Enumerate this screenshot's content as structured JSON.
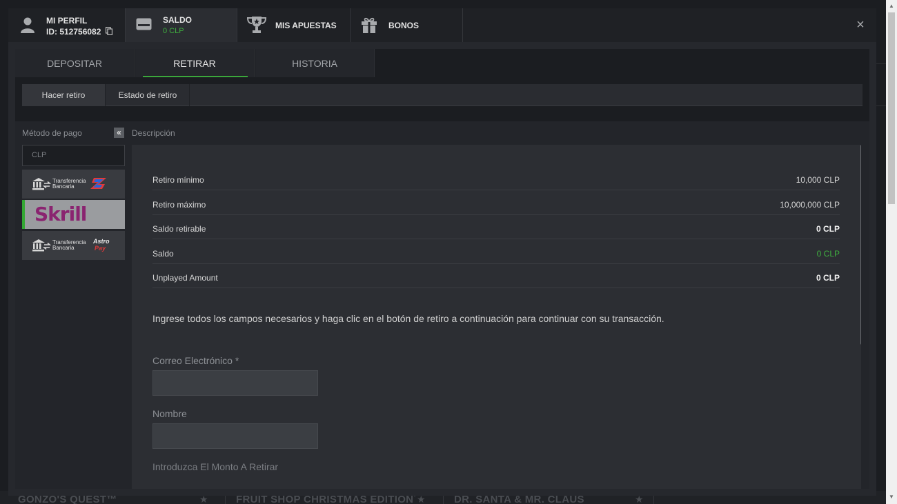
{
  "tabs": [
    {
      "title": "MI PERFIL",
      "sub": "ID: 512756082"
    },
    {
      "title": "SALDO",
      "sub": "0 CLP"
    },
    {
      "title": "MIS APUESTAS"
    },
    {
      "title": "BONOS"
    }
  ],
  "close_label": "×",
  "subtabs": [
    "DEPOSITAR",
    "RETIRAR",
    "HISTORIA"
  ],
  "subtabs2": [
    "Hacer retiro",
    "Estado de retiro"
  ],
  "sidebar": {
    "label": "Método de pago",
    "collapse": "«",
    "currency": "CLP",
    "methods": [
      {
        "name": "Transferencia Bancaria",
        "line1": "Transferencia",
        "line2": "Bancaria"
      },
      {
        "name": "Skrill",
        "label": "Skrill"
      },
      {
        "name": "Transferencia Bancaria AstroPay",
        "line1": "Transferencia",
        "line2": "Bancaria",
        "brand1": "Astro",
        "brand2": "Pay"
      }
    ]
  },
  "description": {
    "label": "Descripción",
    "rows": [
      {
        "k": "Retiro mínimo",
        "v": "10,000 CLP"
      },
      {
        "k": "Retiro máximo",
        "v": "10,000,000 CLP"
      },
      {
        "k": "Saldo retirable",
        "v": "0 CLP"
      },
      {
        "k": "Saldo",
        "v": "0 CLP"
      },
      {
        "k": "Unplayed Amount",
        "v": "0 CLP"
      }
    ],
    "instructions": "Ingrese todos los campos necesarios y haga clic en el botón de retiro a continuación para continuar con su transacción.",
    "fields": [
      "Correo Electrónico *",
      "Nombre",
      "Introduzca El Monto A Retirar"
    ]
  },
  "background_games": [
    "GONZO'S QUEST™",
    "FRUIT SHOP CHRISTMAS EDITION™",
    "DR. SANTA & MR. CLAUS"
  ],
  "colors": {
    "green": "#3fae3f",
    "accent": "#3ba73b",
    "skrill": "#8a2470"
  }
}
